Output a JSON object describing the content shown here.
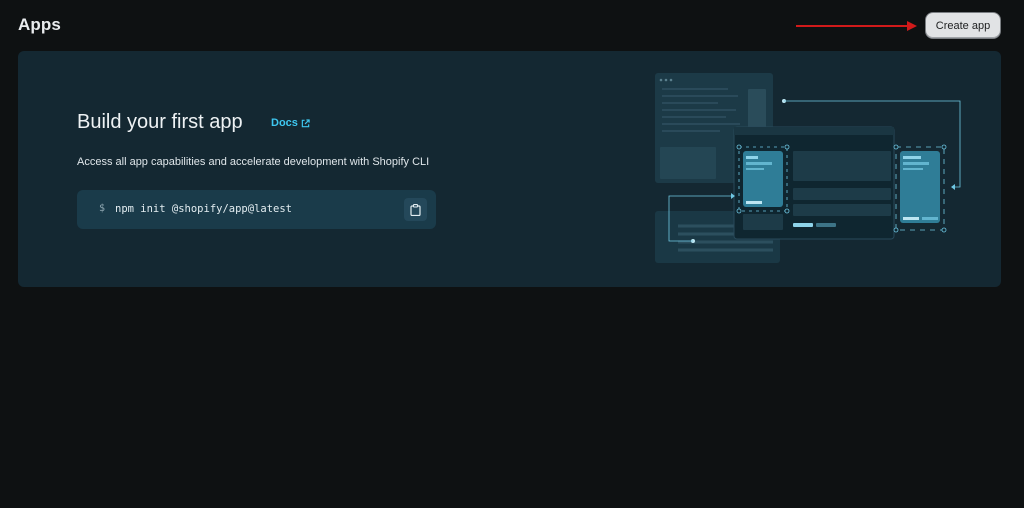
{
  "header": {
    "title": "Apps",
    "create_button_label": "Create app"
  },
  "banner": {
    "title": "Build your first app",
    "docs_link_label": "Docs",
    "description": "Access all app capabilities and accelerate development with Shopify CLI",
    "command_prompt": "$",
    "command": "npm init @shopify/app@latest"
  },
  "icons": {
    "docs": "external-link-icon",
    "copy": "clipboard-icon",
    "annotation": "red-arrow-icon"
  },
  "colors": {
    "background": "#0e1112",
    "card_background": "#142832",
    "accent_link": "#3ec7f0",
    "annotation_arrow": "#d11a1a",
    "button_background": "#e1e3e5"
  }
}
